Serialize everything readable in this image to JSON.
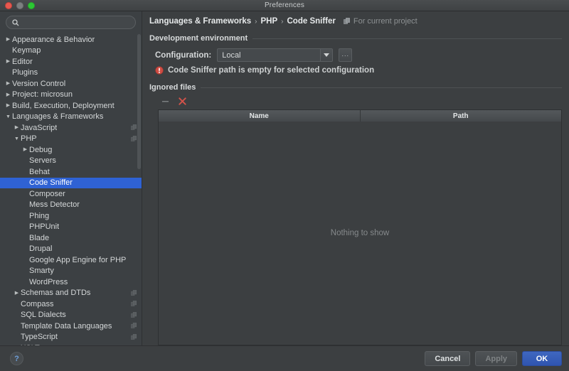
{
  "window": {
    "title": "Preferences",
    "traffic_lights": [
      "close-red",
      "minimize-disabled",
      "zoom-green"
    ]
  },
  "search": {
    "value": "",
    "placeholder": "",
    "icon": "search-icon"
  },
  "sidebar": {
    "items": [
      {
        "label": "Appearance & Behavior",
        "indent": 0,
        "arrow": "collapsed",
        "selected": false,
        "copy_icon": false
      },
      {
        "label": "Keymap",
        "indent": 0,
        "arrow": "none",
        "selected": false,
        "copy_icon": false
      },
      {
        "label": "Editor",
        "indent": 0,
        "arrow": "collapsed",
        "selected": false,
        "copy_icon": false
      },
      {
        "label": "Plugins",
        "indent": 0,
        "arrow": "none",
        "selected": false,
        "copy_icon": false
      },
      {
        "label": "Version Control",
        "indent": 0,
        "arrow": "collapsed",
        "selected": false,
        "copy_icon": false
      },
      {
        "label": "Project: microsun",
        "indent": 0,
        "arrow": "collapsed",
        "selected": false,
        "copy_icon": false
      },
      {
        "label": "Build, Execution, Deployment",
        "indent": 0,
        "arrow": "collapsed",
        "selected": false,
        "copy_icon": false
      },
      {
        "label": "Languages & Frameworks",
        "indent": 0,
        "arrow": "expanded",
        "selected": false,
        "copy_icon": false
      },
      {
        "label": "JavaScript",
        "indent": 1,
        "arrow": "collapsed",
        "selected": false,
        "copy_icon": true
      },
      {
        "label": "PHP",
        "indent": 1,
        "arrow": "expanded",
        "selected": false,
        "copy_icon": true
      },
      {
        "label": "Debug",
        "indent": 2,
        "arrow": "collapsed",
        "selected": false,
        "copy_icon": false
      },
      {
        "label": "Servers",
        "indent": 2,
        "arrow": "none",
        "selected": false,
        "copy_icon": false
      },
      {
        "label": "Behat",
        "indent": 2,
        "arrow": "none",
        "selected": false,
        "copy_icon": false
      },
      {
        "label": "Code Sniffer",
        "indent": 2,
        "arrow": "none",
        "selected": true,
        "copy_icon": false
      },
      {
        "label": "Composer",
        "indent": 2,
        "arrow": "none",
        "selected": false,
        "copy_icon": false
      },
      {
        "label": "Mess Detector",
        "indent": 2,
        "arrow": "none",
        "selected": false,
        "copy_icon": false
      },
      {
        "label": "Phing",
        "indent": 2,
        "arrow": "none",
        "selected": false,
        "copy_icon": false
      },
      {
        "label": "PHPUnit",
        "indent": 2,
        "arrow": "none",
        "selected": false,
        "copy_icon": false
      },
      {
        "label": "Blade",
        "indent": 2,
        "arrow": "none",
        "selected": false,
        "copy_icon": false
      },
      {
        "label": "Drupal",
        "indent": 2,
        "arrow": "none",
        "selected": false,
        "copy_icon": false
      },
      {
        "label": "Google App Engine for PHP",
        "indent": 2,
        "arrow": "none",
        "selected": false,
        "copy_icon": false
      },
      {
        "label": "Smarty",
        "indent": 2,
        "arrow": "none",
        "selected": false,
        "copy_icon": false
      },
      {
        "label": "WordPress",
        "indent": 2,
        "arrow": "none",
        "selected": false,
        "copy_icon": false
      },
      {
        "label": "Schemas and DTDs",
        "indent": 1,
        "arrow": "collapsed",
        "selected": false,
        "copy_icon": true
      },
      {
        "label": "Compass",
        "indent": 1,
        "arrow": "none",
        "selected": false,
        "copy_icon": true
      },
      {
        "label": "SQL Dialects",
        "indent": 1,
        "arrow": "none",
        "selected": false,
        "copy_icon": true
      },
      {
        "label": "Template Data Languages",
        "indent": 1,
        "arrow": "none",
        "selected": false,
        "copy_icon": true
      },
      {
        "label": "TypeScript",
        "indent": 1,
        "arrow": "none",
        "selected": false,
        "copy_icon": true
      },
      {
        "label": "XSLT",
        "indent": 1,
        "arrow": "none",
        "selected": false,
        "copy_icon": false
      }
    ]
  },
  "breadcrumb": {
    "parts": [
      "Languages & Frameworks",
      "PHP",
      "Code Sniffer"
    ],
    "separator": "›",
    "scope_label": "For current project",
    "scope_icon": "copy-scope-icon"
  },
  "dev_environment": {
    "section_title": "Development environment",
    "config_label": "Configuration:",
    "config_value": "Local",
    "config_options": [
      "Local"
    ],
    "dropdown_icon": "chevron-down-icon",
    "ellipsis_label": "...",
    "error_icon": "error-circle-icon",
    "error_text": "Code Sniffer path is empty for selected configuration"
  },
  "ignored_files": {
    "section_title": "Ignored files",
    "toolbar": [
      {
        "name": "remove-button",
        "icon": "minus-icon",
        "enabled": false
      },
      {
        "name": "delete-button",
        "icon": "close-x-icon",
        "enabled": true
      }
    ],
    "columns": [
      "Name",
      "Path"
    ],
    "rows": [],
    "empty_text": "Nothing to show"
  },
  "footer": {
    "help_label": "?",
    "cancel_label": "Cancel",
    "apply_label": "Apply",
    "apply_enabled": false,
    "ok_label": "OK"
  },
  "colors": {
    "window_bg": "#3c3f41",
    "sidebar_bg": "#3c4043",
    "selection_blue": "#2f62d4",
    "default_button_blue": "#3f67c0",
    "error_red": "#cf4c43",
    "text_primary": "#d4d7d8",
    "text_muted": "#85898b"
  }
}
